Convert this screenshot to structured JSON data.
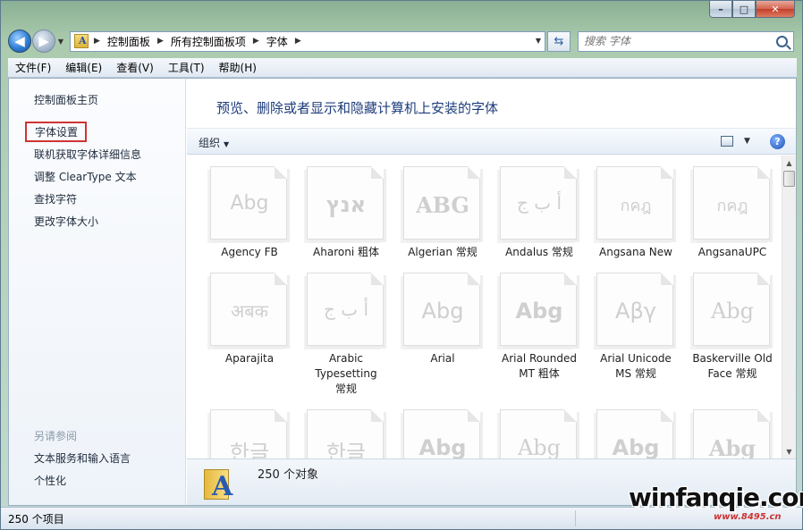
{
  "window": {
    "caption_buttons": {
      "minimize": "–",
      "maximize": "□",
      "close": "✕"
    }
  },
  "nav": {
    "back_glyph": "◀",
    "forward_glyph": "▶"
  },
  "address": {
    "breadcrumbs": [
      "控制面板",
      "所有控制面板项",
      "字体"
    ]
  },
  "search": {
    "placeholder": "搜索 字体"
  },
  "menubar": {
    "items": [
      "文件(F)",
      "编辑(E)",
      "查看(V)",
      "工具(T)",
      "帮助(H)"
    ]
  },
  "sidebar": {
    "home": "控制面板主页",
    "links": [
      "字体设置",
      "联机获取字体详细信息",
      "调整 ClearType 文本",
      "查找字符",
      "更改字体大小"
    ],
    "see_also_title": "另请参阅",
    "see_also": [
      "文本服务和输入语言",
      "个性化"
    ]
  },
  "content": {
    "heading": "预览、删除或者显示和隐藏计算机上安装的字体",
    "organize_label": "组织",
    "help_glyph": "?"
  },
  "fonts": [
    {
      "name": "Agency FB",
      "sample": "Abg"
    },
    {
      "name": "Aharoni 粗体",
      "sample": "אנץ"
    },
    {
      "name": "Algerian 常规",
      "sample": "ABG"
    },
    {
      "name": "Andalus 常规",
      "sample": "أ ب ج"
    },
    {
      "name": "Angsana New",
      "sample": "กคฎ"
    },
    {
      "name": "AngsanaUPC",
      "sample": "กคฎ"
    },
    {
      "name": "Aparajita",
      "sample": "अबक"
    },
    {
      "name": "Arabic Typesetting 常规",
      "sample": "أ ب ج"
    },
    {
      "name": "Arial",
      "sample": "Abg"
    },
    {
      "name": "Arial Rounded MT 粗体",
      "sample": "Abg"
    },
    {
      "name": "Arial Unicode MS 常规",
      "sample": "Αβγ"
    },
    {
      "name": "Baskerville Old Face 常规",
      "sample": "Abg"
    },
    {
      "name": "",
      "sample": "한글"
    },
    {
      "name": "",
      "sample": "한글"
    },
    {
      "name": "",
      "sample": "Abg"
    },
    {
      "name": "",
      "sample": "Abg"
    },
    {
      "name": "",
      "sample": "Abg"
    },
    {
      "name": "",
      "sample": "Abg"
    }
  ],
  "details": {
    "count_text": "250 个对象"
  },
  "statusbar": {
    "text": "250 个项目"
  },
  "watermark": {
    "main": "winfanqie.com",
    "sub": "www.8495.cn"
  }
}
